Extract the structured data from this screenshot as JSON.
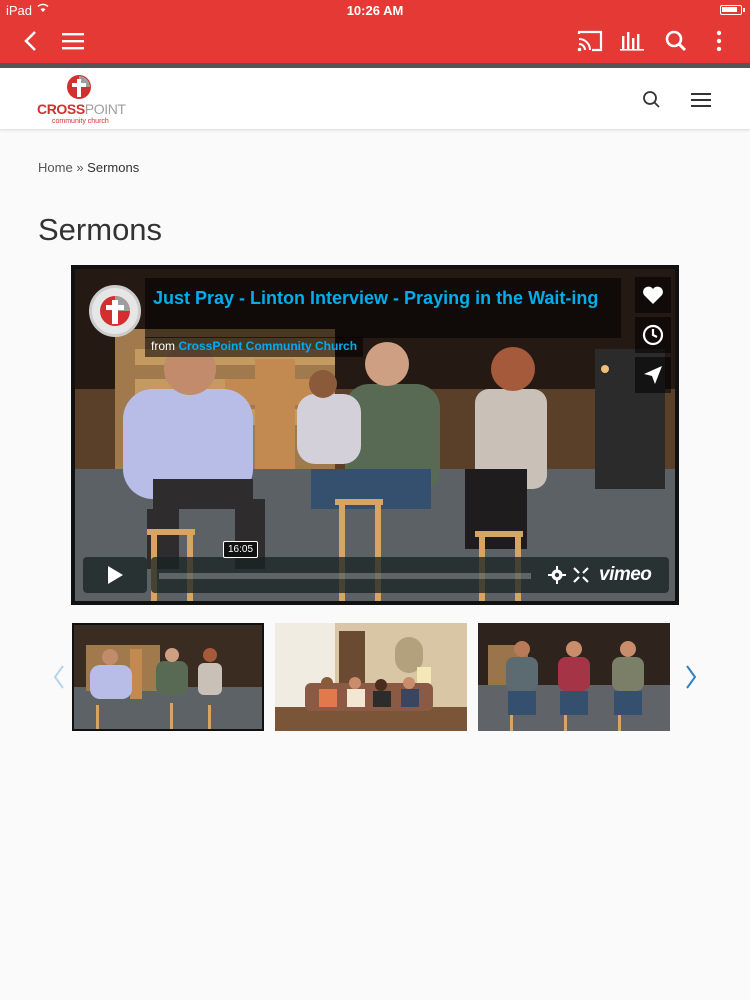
{
  "status_bar": {
    "device": "iPad",
    "time": "10:26 AM",
    "battery_level": 0.9
  },
  "app_bar": {
    "back_icon": "chevron-left-icon",
    "menu_icon": "hamburger-icon",
    "actions": [
      "cast-icon",
      "audio-bars-icon",
      "search-icon",
      "more-vertical-icon"
    ],
    "color": "#e53935"
  },
  "site": {
    "logo": {
      "name_part1": "CROSS",
      "name_part2": "POINT",
      "tagline": "community church"
    },
    "search_icon": "search-icon",
    "menu_icon": "hamburger-icon"
  },
  "breadcrumb": {
    "home": "Home",
    "separator": "»",
    "current": "Sermons"
  },
  "page_title": "Sermons",
  "video": {
    "title": "Just Pray - Linton Interview - Praying in the Wait-ing",
    "from_prefix": "from",
    "channel": "CrossPoint Community Church",
    "duration": "16:05",
    "progress": 0.0,
    "side_buttons": [
      "heart-icon",
      "clock-icon",
      "share-icon"
    ],
    "controls": [
      "settings-icon",
      "fullscreen-icon"
    ],
    "brand": "vimeo",
    "accent": "#00adef"
  },
  "carousel": {
    "prev_icon": "chevron-left-icon",
    "next_icon": "chevron-right-icon",
    "thumbnails": [
      {
        "id": "thumb-1",
        "active": true
      },
      {
        "id": "thumb-2",
        "active": false
      },
      {
        "id": "thumb-3",
        "active": false
      }
    ]
  }
}
